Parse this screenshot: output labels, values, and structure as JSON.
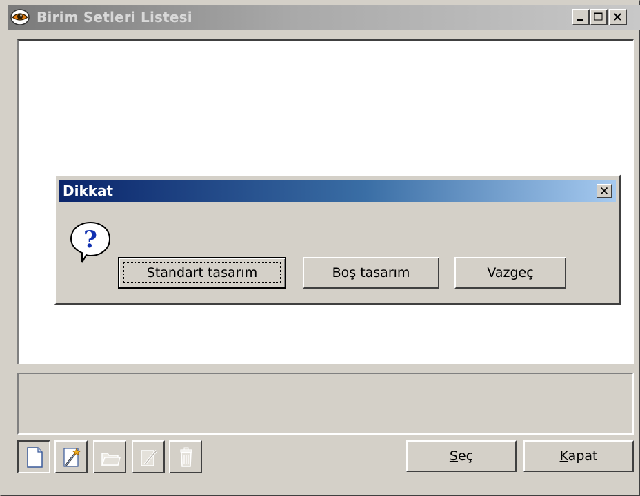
{
  "window": {
    "title": "Birim Setleri Listesi",
    "controls": [
      "minimize-icon",
      "maximize-icon",
      "close-icon"
    ]
  },
  "dialog": {
    "title": "Dikkat",
    "icon": "question-icon",
    "buttons": {
      "standard": {
        "accel": "S",
        "rest": "tandart tasarım"
      },
      "empty": {
        "accel": "B",
        "rest": "oş tasarım"
      },
      "cancel": {
        "accel": "V",
        "rest": "azgeç"
      }
    }
  },
  "toolbar": {
    "tools": [
      "new-document-icon",
      "wizard-icon",
      "open-icon",
      "edit-icon",
      "delete-icon"
    ]
  },
  "footer": {
    "select": {
      "accel": "S",
      "rest": "eç"
    },
    "close": {
      "accel": "K",
      "rest": "apat"
    }
  },
  "colors": {
    "face": "#d4d0c8",
    "dialog_title_start": "#0a246a",
    "dialog_title_end": "#a6caf0"
  }
}
